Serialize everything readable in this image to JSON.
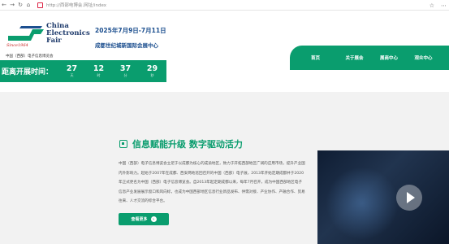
{
  "browser": {
    "back_icon": "arrow-left-icon",
    "forward_icon": "arrow-right-icon",
    "reload_icon": "reload-icon",
    "home_icon": "home-icon",
    "url": "http://西部电博会.网址/index",
    "star_icon": "star-icon",
    "more_icon": "more-icon"
  },
  "header": {
    "logo_title_line1": "China",
    "logo_title_line2": "Electronics",
    "logo_title_line3": "Fair",
    "logo_since": "Since1964",
    "logo_subtitle": "中国（西部）电子信息博览会",
    "fair_date": "2025年7月9日-7月11日",
    "fair_venue": "成都世纪城新国际会展中心"
  },
  "nav": {
    "items": [
      "首页",
      "关于展会",
      "展商中心",
      "观众中心"
    ]
  },
  "countdown": {
    "label": "距离开展时间：",
    "units": [
      {
        "value": "27",
        "unit": "天"
      },
      {
        "value": "12",
        "unit": "时"
      },
      {
        "value": "37",
        "unit": "分"
      },
      {
        "value": "29",
        "unit": "秒"
      }
    ]
  },
  "intro": {
    "heading": "信息赋能升级 数字驱动活力",
    "paragraph": "中国（西部）电子信息博览会立足于以成都为核心的成渝地区，致力于开拓西部地区广阔的应用市场，提升产业国内外影响力。起始于2007年在成都、西安两地巡回召开的中国（西部）电子展，2013年开始定期成都并于2020年正式更名为中国（西部）电子信息博览会。自2013年起定期成都以来，每年7月召开，成为中国西部地区电子信息产业发展展示窗口和风向标，也成为中国西部地区信息行业新品发布、供需对接、产业协作、产融合作、贸易往来、人才交流的综合平台。",
    "more_label": "查看更多",
    "more_icon": "arrow-right-circle-icon",
    "chip_icon": "chip-icon"
  },
  "video": {
    "play_icon": "play-icon"
  },
  "colors": {
    "brand_green": "#0a9d6e",
    "brand_blue": "#1c4f8f",
    "logo_red": "#c8201f"
  }
}
